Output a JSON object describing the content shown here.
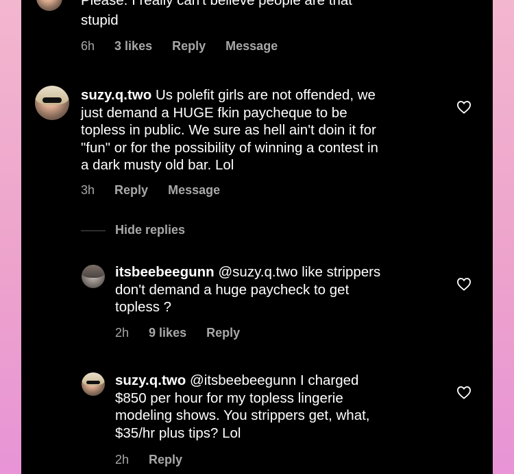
{
  "comments": [
    {
      "id": "c0",
      "cut_line": "Please. I really can't believe people are that",
      "text": "stupid",
      "meta": {
        "time": "6h",
        "likes": "3 likes",
        "reply": "Reply",
        "message": "Message"
      }
    },
    {
      "id": "c1",
      "username": "suzy.q.two",
      "text": " Us polefit girls are not offended, we\njust demand a HUGE fkin paycheque to be\ntopless in public. We sure as hell ain't doin it for\n\"fun\" or for the possibility of winning a contest in\na dark musty old bar. Lol",
      "meta": {
        "time": "3h",
        "reply": "Reply",
        "message": "Message"
      }
    }
  ],
  "hide_replies": "Hide replies",
  "replies": [
    {
      "id": "r1",
      "username": "itsbeebeegunn",
      "text": " @suzy.q.two like strippers\ndon't demand a huge paycheck to get\ntopless ?",
      "meta": {
        "time": "2h",
        "likes": "9 likes",
        "reply": "Reply"
      }
    },
    {
      "id": "r2",
      "username": "suzy.q.two",
      "text": " @itsbeebeegunn I charged\n$850 per hour for my topless lingerie\nmodeling shows. You strippers get, what,\n$35/hr plus tips? Lol",
      "meta": {
        "time": "2h",
        "reply": "Reply"
      }
    }
  ],
  "icons": {
    "like": "heart-outline-icon"
  },
  "colors": {
    "background": "#000000",
    "text": "#ffffff",
    "meta": "#a8a8a8"
  }
}
